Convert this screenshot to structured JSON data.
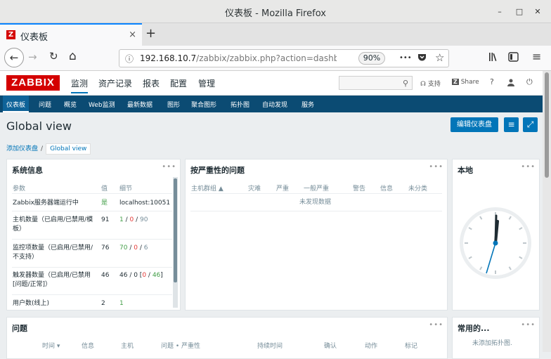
{
  "window": {
    "title": "仪表板 - Mozilla Firefox",
    "minimize": "–",
    "maximize": "□",
    "close": "✕"
  },
  "tab": {
    "favicon": "Z",
    "label": "仪表板",
    "close": "×",
    "new_tab": "+"
  },
  "nav": {
    "back": "←",
    "forward": "→",
    "reload": "↻",
    "home": "⌂",
    "url_host": "192.168.10.7",
    "url_path": "/zabbix/zabbix.php?action=dashboa",
    "zoom": "90%",
    "more": "•••",
    "pocket": "pocket-icon",
    "star": "☆",
    "library": "|||\\",
    "sidebar": "▥",
    "menu": "≡"
  },
  "zabbix": {
    "logo": "ZABBIX",
    "main_menu": [
      "监测",
      "资产记录",
      "报表",
      "配置",
      "管理"
    ],
    "search_placeholder": "",
    "support": "支持",
    "share": "Share",
    "help": "?",
    "user": "user-icon",
    "logout": "⏻",
    "sub_menu": [
      "仪表板",
      "问题",
      "概览",
      "Web监测",
      "最新数据",
      "图形",
      "聚合图形",
      "拓扑图",
      "自动发现",
      "服务"
    ],
    "page_title": "Global view",
    "edit_dashboard": "编辑仪表盘",
    "breadcrumb": [
      "添加仪表盘",
      "Global view"
    ]
  },
  "system_info": {
    "title": "系统信息",
    "headers": [
      "参数",
      "值",
      "细节"
    ],
    "rows": [
      {
        "param": "Zabbix服务器端运行中",
        "value": "是",
        "detail": "localhost:10051"
      },
      {
        "param": "主机数量（已启用/已禁用/模板）",
        "value": "91",
        "d1": "1",
        "d2": "0",
        "d3": "90"
      },
      {
        "param": "监控项数量（已启用/已禁用/不支持）",
        "value": "76",
        "d1": "70",
        "d2": "0",
        "d3": "6"
      },
      {
        "param": "触发器数量（已启用/已禁用 [问题/正常]）",
        "value": "46",
        "d0": "46 / 0 [",
        "d1": "0",
        "d2": "46",
        "d3": "]"
      },
      {
        "param": "用户数(线上)",
        "value": "2",
        "detail": "1"
      }
    ]
  },
  "problems_by_severity": {
    "title": "按严重性的问题",
    "headers": [
      "主机群组 ▲",
      "灾难",
      "严重",
      "一般严重",
      "警告",
      "信息",
      "未分类"
    ],
    "empty": "未发现数据"
  },
  "clock": {
    "title": "本地"
  },
  "problems": {
    "title": "问题",
    "headers": [
      "时间 ▾",
      "信息",
      "主机",
      "问题 • 严重性",
      "持续时间",
      "确认",
      "动作",
      "标记"
    ]
  },
  "favorites": {
    "title": "常用的...",
    "empty": "未添加拓扑图."
  },
  "widget_menu": "•••"
}
